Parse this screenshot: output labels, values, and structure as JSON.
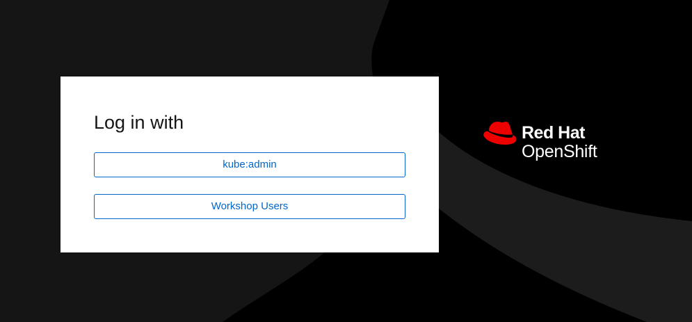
{
  "login": {
    "title": "Log in with",
    "providers": [
      {
        "label": "kube:admin"
      },
      {
        "label": "Workshop Users"
      }
    ]
  },
  "brand": {
    "line1": "Red Hat",
    "line2": "OpenShift",
    "logo_icon": "red-hat-fedora-icon"
  },
  "colors": {
    "background_light": "#151515",
    "background_dark": "#000000",
    "background_mid": "#1f1f1f",
    "card": "#ffffff",
    "link_blue": "#0066cc",
    "brand_red": "#ee0000",
    "title_text": "#151515"
  }
}
